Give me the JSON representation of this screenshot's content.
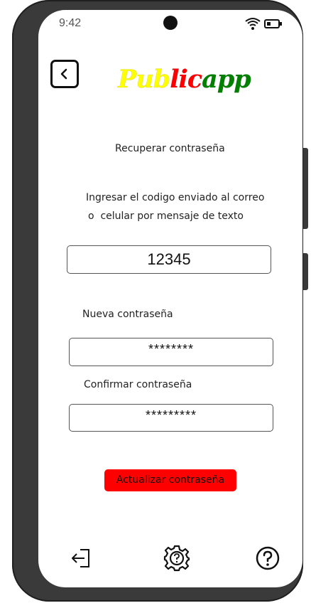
{
  "status_bar": {
    "time": "9:42",
    "icons": [
      "wifi-icon",
      "battery-icon"
    ]
  },
  "header": {
    "back_icon": "chevron-left-icon",
    "logo": {
      "parts": [
        {
          "text": "Pub",
          "color": "#ffff00"
        },
        {
          "text": "lic",
          "color": "#ff0000"
        },
        {
          "text": "app",
          "color": "#008000"
        }
      ]
    }
  },
  "main": {
    "title": "Recuperar contraseña",
    "instruction_line1": "Ingresar el codigo enviado al correo",
    "instruction_line2": "o  celular por mensaje de texto",
    "code_value": "12345",
    "new_password_label": "Nueva contraseña",
    "new_password_value": "********",
    "confirm_password_label": "Confirmar contraseña",
    "confirm_password_value": "*********",
    "update_button_label": "Actualizar contraseña",
    "update_button_color": "#ff0000"
  },
  "bottom_nav": {
    "items": [
      {
        "icon": "logout-icon"
      },
      {
        "icon": "settings-help-icon"
      },
      {
        "icon": "help-icon"
      }
    ]
  }
}
